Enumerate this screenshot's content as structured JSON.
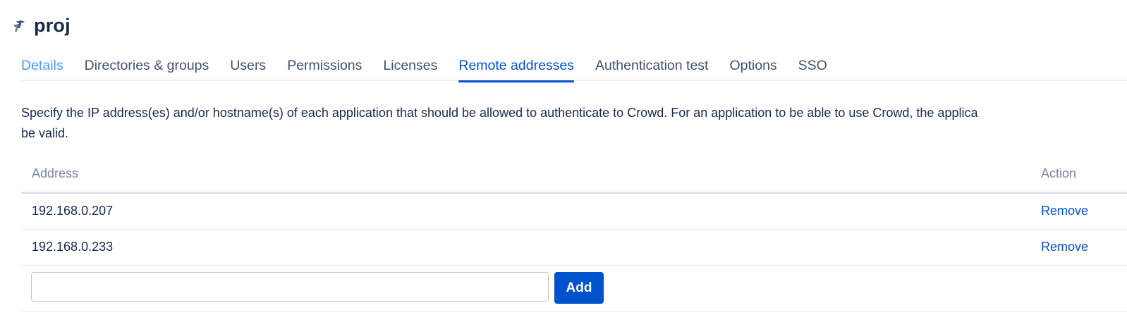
{
  "app": {
    "title": "proj",
    "icon": "crowd-app-icon"
  },
  "tabs": [
    {
      "label": "Details"
    },
    {
      "label": "Directories & groups"
    },
    {
      "label": "Users"
    },
    {
      "label": "Permissions"
    },
    {
      "label": "Licenses"
    },
    {
      "label": "Remote addresses",
      "active": true
    },
    {
      "label": "Authentication test"
    },
    {
      "label": "Options"
    },
    {
      "label": "SSO"
    }
  ],
  "description": {
    "line1": "Specify the IP address(es) and/or hostname(s) of each application that should be allowed to authenticate to Crowd. For an application to be able to use Crowd, the applica",
    "line2": "be valid."
  },
  "table": {
    "headers": {
      "address": "Address",
      "action": "Action"
    },
    "rows": [
      {
        "address": "192.168.0.207",
        "action": "Remove"
      },
      {
        "address": "192.168.0.233",
        "action": "Remove"
      }
    ]
  },
  "add_form": {
    "value": "",
    "placeholder": "",
    "button_label": "Add"
  },
  "colors": {
    "accent": "#0052cc",
    "details_tab": "#4c9aff",
    "text": "#172b4d",
    "muted": "#7a869a"
  }
}
